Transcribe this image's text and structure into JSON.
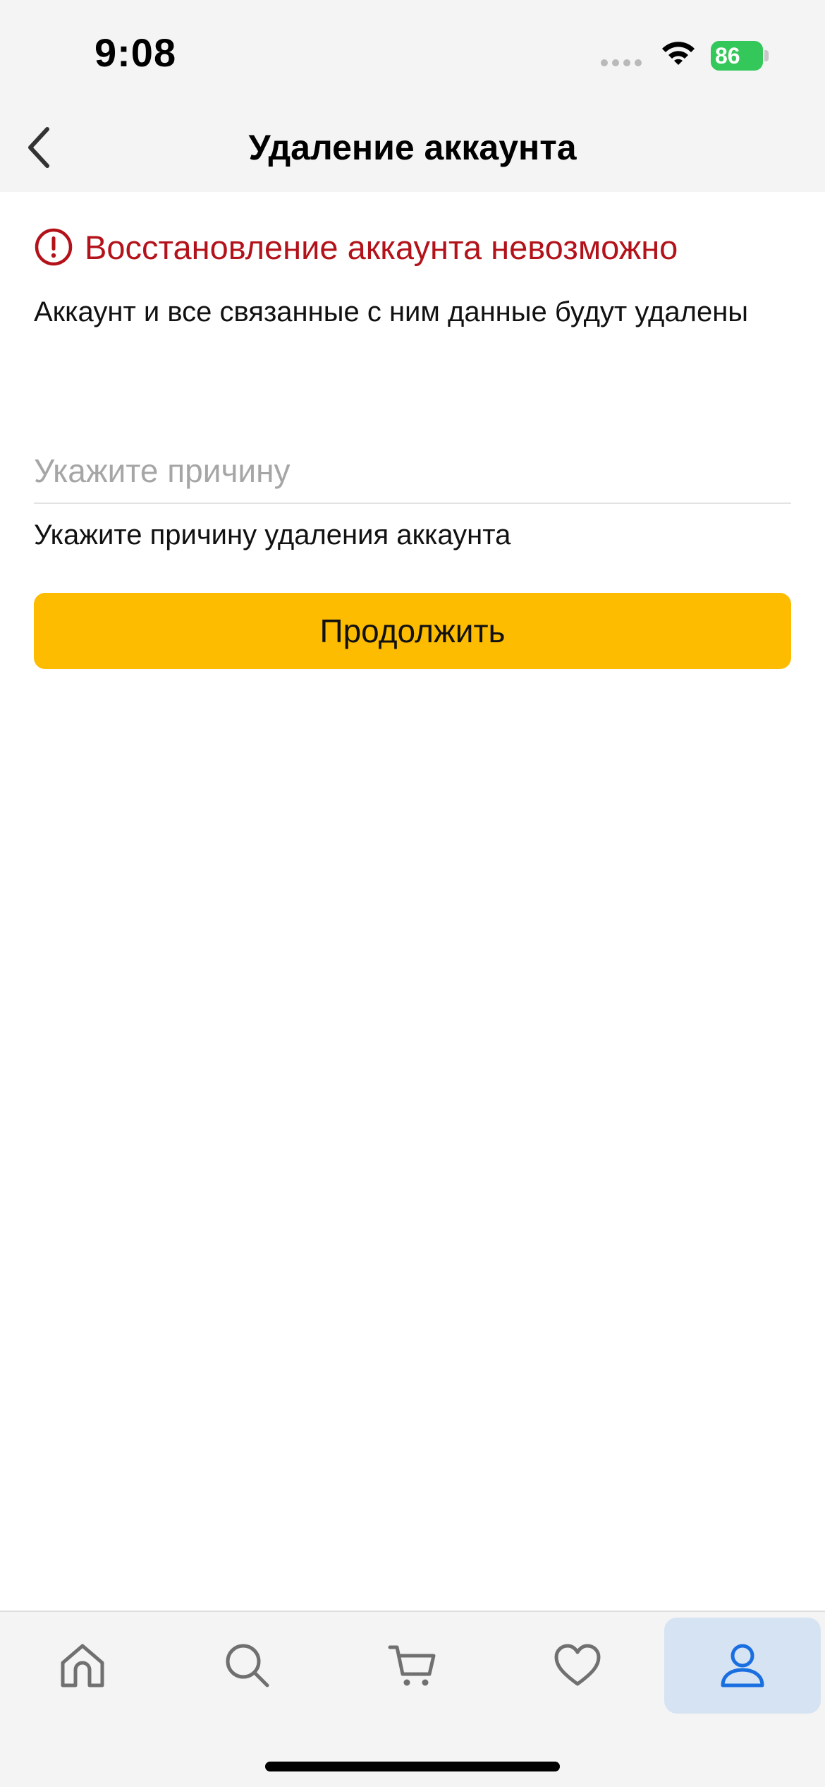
{
  "status_bar": {
    "time": "9:08",
    "battery_level": "86",
    "icons": [
      "signal-icon",
      "wifi-icon",
      "battery-charging-icon"
    ]
  },
  "nav": {
    "title": "Удаление аккаунта",
    "back_icon": "chevron-left-icon"
  },
  "warning": {
    "icon": "alert-circle-icon",
    "title": "Восстановление аккаунта невозможно",
    "text": "Аккаунт и все связанные с ним данные будут удалены"
  },
  "reason": {
    "placeholder": "Укажите причину",
    "value": "",
    "helper": "Укажите причину удаления аккаунта"
  },
  "actions": {
    "continue_label": "Продолжить"
  },
  "tab_bar": {
    "tabs": [
      {
        "name": "home",
        "icon": "home-icon",
        "active": false
      },
      {
        "name": "search",
        "icon": "search-icon",
        "active": false
      },
      {
        "name": "cart",
        "icon": "cart-icon",
        "active": false
      },
      {
        "name": "favorites",
        "icon": "heart-icon",
        "active": false
      },
      {
        "name": "profile",
        "icon": "user-icon",
        "active": true
      }
    ]
  },
  "colors": {
    "accent_button": "#fdbc00",
    "warning": "#b3121a",
    "active_tab_bg": "#d6e3f3",
    "active_tab_icon": "#1a6fe0",
    "inactive_icon": "#707070",
    "battery": "#34c759"
  }
}
